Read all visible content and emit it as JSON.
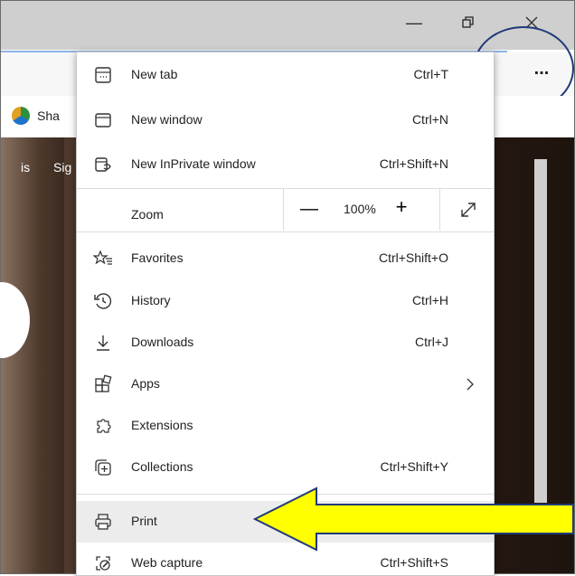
{
  "window": {
    "minimize_icon": "minimize-icon",
    "restore_icon": "restore-icon",
    "close_icon": "close-icon"
  },
  "toolbar": {
    "more_label": "..."
  },
  "favorites_bar": {
    "item_label": "Sha"
  },
  "page": {
    "nav_item_1": "is",
    "nav_item_2": "Sig"
  },
  "menu": {
    "items": [
      {
        "label": "New tab",
        "shortcut": "Ctrl+T",
        "icon": "new-tab-icon"
      },
      {
        "label": "New window",
        "shortcut": "Ctrl+N",
        "icon": "new-window-icon"
      },
      {
        "label": "New InPrivate window",
        "shortcut": "Ctrl+Shift+N",
        "icon": "inprivate-icon"
      },
      {
        "label": "Favorites",
        "shortcut": "Ctrl+Shift+O",
        "icon": "favorites-icon"
      },
      {
        "label": "History",
        "shortcut": "Ctrl+H",
        "icon": "history-icon"
      },
      {
        "label": "Downloads",
        "shortcut": "Ctrl+J",
        "icon": "download-icon"
      },
      {
        "label": "Apps",
        "shortcut": "",
        "icon": "apps-icon"
      },
      {
        "label": "Extensions",
        "shortcut": "",
        "icon": "extensions-icon"
      },
      {
        "label": "Collections",
        "shortcut": "Ctrl+Shift+Y",
        "icon": "collections-icon"
      },
      {
        "label": "Print",
        "shortcut": "",
        "icon": "print-icon"
      },
      {
        "label": "Web capture",
        "shortcut": "Ctrl+Shift+S",
        "icon": "web-capture-icon"
      }
    ],
    "zoom": {
      "label": "Zoom",
      "value": "100%",
      "minus": "—",
      "plus": "+"
    }
  },
  "annotation": {
    "arrow_color": "#ffff00",
    "arrow_outline": "#1f3a78",
    "circle_color": "#1f3a78"
  }
}
